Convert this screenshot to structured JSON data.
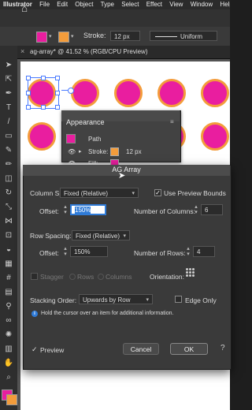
{
  "menubar": {
    "app": "Illustrator",
    "items": [
      "File",
      "Edit",
      "Object",
      "Type",
      "Select",
      "Effect",
      "View",
      "Window",
      "Help"
    ]
  },
  "controlbar": {
    "fill_color": "#e91e9f",
    "stroke_color": "#f39c3b",
    "stroke_label": "Stroke:",
    "stroke_value": "12 px",
    "profile": "Uniform"
  },
  "document": {
    "tab_title": "ag-array* @ 41.52 % (RGB/CPU Preview)"
  },
  "artwork": {
    "fill": "#e91e9f",
    "stroke": "#f39c3b"
  },
  "appearance": {
    "title": "Appearance",
    "object": "Path",
    "rows": [
      {
        "label": "Stroke:",
        "value": "12 px",
        "swatch": "#f39c3b"
      },
      {
        "label": "Fill:",
        "value": "",
        "swatch": "#e91e9f"
      }
    ]
  },
  "dialog": {
    "title": "AG Array",
    "column_spacing_label": "Column Spacing:",
    "column_spacing_value": "Fixed (Relative)",
    "use_preview_bounds_label": "Use Preview Bounds",
    "offset_label": "Offset:",
    "col_offset_value": "150%",
    "num_columns_label": "Number of Columns:",
    "num_columns_value": "6",
    "row_spacing_label": "Row Spacing:",
    "row_spacing_value": "Fixed (Relative)",
    "row_offset_value": "150%",
    "num_rows_label": "Number of Rows:",
    "num_rows_value": "4",
    "stagger_label": "Stagger",
    "rows_label": "Rows",
    "columns_label": "Columns",
    "orientation_label": "Orientation:",
    "stacking_order_label": "Stacking Order:",
    "stacking_order_value": "Upwards by Row",
    "edge_only_label": "Edge Only",
    "info_text": "Hold the cursor over an item for additional information.",
    "preview_label": "Preview",
    "cancel_label": "Cancel",
    "ok_label": "OK"
  }
}
